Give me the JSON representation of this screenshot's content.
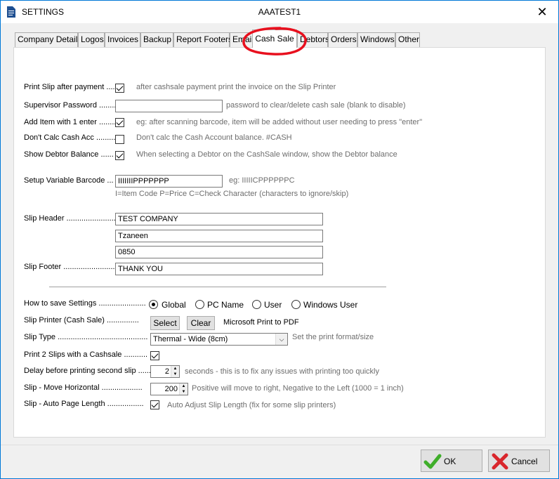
{
  "window": {
    "title": "SETTINGS",
    "center_title": "AAATEST1",
    "close_symbol": "✕"
  },
  "tabs": [
    {
      "label": "Company Details"
    },
    {
      "label": "Logos"
    },
    {
      "label": "Invoices"
    },
    {
      "label": "Backup"
    },
    {
      "label": "Report Footers"
    },
    {
      "label": "Email"
    },
    {
      "label": "Cash Sale",
      "active": true
    },
    {
      "label": "Debtors"
    },
    {
      "label": "Orders"
    },
    {
      "label": "Windows"
    },
    {
      "label": "Other"
    }
  ],
  "options": {
    "print_slip": {
      "label": "Print Slip after payment .....",
      "checked": true,
      "hint": "after cashsale payment print the invoice on the Slip Printer"
    },
    "supervisor_password": {
      "label": "Supervisor Password .........",
      "value": "",
      "hint": "password to clear/delete cash sale (blank to disable)"
    },
    "add_item": {
      "label": "Add Item with 1 enter .........",
      "checked": true,
      "hint": "eg: after scanning barcode, item will be added without user needing to press \"enter\""
    },
    "dont_calc": {
      "label": "Don't Calc Cash Acc .........",
      "checked": false,
      "hint": "Don't calc the Cash Account balance. #CASH"
    },
    "show_debtor": {
      "label": "Show Debtor Balance ......",
      "checked": true,
      "hint": "When selecting a Debtor on the CashSale window, show the Debtor balance"
    }
  },
  "barcode": {
    "label": "Setup Variable Barcode ...",
    "value": "IIIIIIIPPPPPPP",
    "example": "eg: IIIIICPPPPPPC",
    "help": "I=Item Code   P=Price   C=Check Character (characters to ignore/skip)"
  },
  "slip": {
    "header_label": "Slip Header .......................",
    "header_lines": [
      "TEST COMPANY",
      "Tzaneen",
      "0850"
    ],
    "footer_label": "Slip Footer .........................",
    "footer": "THANK YOU"
  },
  "save_settings": {
    "label": "How to save Settings ......................",
    "options": [
      "Global",
      "PC Name",
      "User",
      "Windows User"
    ],
    "selected": "Global"
  },
  "slip_printer": {
    "label": "Slip Printer (Cash Sale) ...............",
    "select_label": "Select",
    "clear_label": "Clear",
    "printer": "Microsoft Print to PDF"
  },
  "slip_type": {
    "label": "Slip Type ..........................................",
    "selected": "Thermal - Wide (8cm)",
    "hint": "Set the print format/size"
  },
  "print_two": {
    "label": "Print 2 Slips with a Cashsale ...........",
    "checked": true
  },
  "delay": {
    "label": "Delay before printing second slip ......",
    "value": "2",
    "hint": "seconds - this is to fix any issues with printing too quickly"
  },
  "move_horizontal": {
    "label": "Slip - Move Horizontal ...................",
    "value": "200",
    "hint": "Positive will move to right, Negative to the Left (1000 = 1 inch)"
  },
  "auto_page": {
    "label": "Slip - Auto Page Length .................",
    "checked": true,
    "hint": "Auto Adjust Slip Length (fix for some slip printers)"
  },
  "buttons": {
    "ok": "OK",
    "cancel": "Cancel"
  },
  "colors": {
    "window_border": "#0078d7",
    "annotation": "#e8101e",
    "ok_check": "#3fae2a",
    "cancel_x": "#d9262c"
  }
}
